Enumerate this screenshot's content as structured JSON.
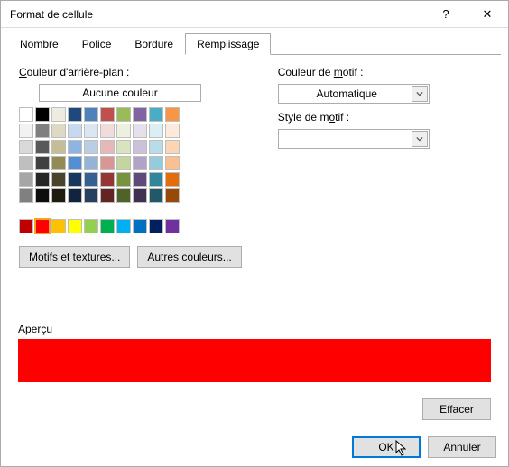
{
  "window": {
    "title": "Format de cellule",
    "help_icon": "?",
    "close_icon": "✕"
  },
  "tabs": {
    "number": "Nombre",
    "font": "Police",
    "border": "Bordure",
    "fill": "Remplissage"
  },
  "fill": {
    "bg_label_pre": "C",
    "bg_label_mid": "ouleur d'arrière-plan :",
    "no_color": "Aucune couleur",
    "effects_btn": "Motifs et textures...",
    "more_colors_btn": "Autres couleurs...",
    "theme_rows": [
      [
        "#ffffff",
        "#000000",
        "#eeece1",
        "#1f497d",
        "#4f81bd",
        "#c0504d",
        "#9bbb59",
        "#8064a2",
        "#4bacc6",
        "#f79646"
      ],
      [
        "#f2f2f2",
        "#7f7f7f",
        "#ddd9c4",
        "#c6d9f1",
        "#dce6f2",
        "#f2dcdb",
        "#ebf1de",
        "#e6e0ec",
        "#dbeef4",
        "#fdeada"
      ],
      [
        "#d9d9d9",
        "#595959",
        "#c4bd97",
        "#8eb4e3",
        "#b9cde5",
        "#e6b9b8",
        "#d7e4bd",
        "#ccc1da",
        "#b7dee8",
        "#fcd5b5"
      ],
      [
        "#bfbfbf",
        "#404040",
        "#948a54",
        "#548ed5",
        "#95b3d7",
        "#da9694",
        "#c3d69b",
        "#b3a2c7",
        "#93cddd",
        "#fac090"
      ],
      [
        "#a6a6a6",
        "#262626",
        "#4a452a",
        "#17375e",
        "#376092",
        "#963634",
        "#77933c",
        "#604a7b",
        "#31869b",
        "#e46c0a"
      ],
      [
        "#808080",
        "#0d0d0d",
        "#1e1c11",
        "#10243f",
        "#254061",
        "#632523",
        "#4f6228",
        "#403152",
        "#215968",
        "#984807"
      ]
    ],
    "standard_row": [
      "#c00000",
      "#ff0000",
      "#ffc000",
      "#ffff00",
      "#92d050",
      "#00b050",
      "#00b0f0",
      "#0070c0",
      "#002060",
      "#7030a0"
    ],
    "selected_color": "#ff0000"
  },
  "pattern": {
    "color_label": "Couleur de ",
    "color_label_u": "m",
    "color_label_post": "otif :",
    "auto": "Automatique",
    "style_label": "Style de m",
    "style_label_u": "o",
    "style_label_post": "tif :"
  },
  "preview": {
    "label": "Aperçu",
    "color": "#ff0000"
  },
  "buttons": {
    "clear": "Effacer",
    "ok": "OK",
    "cancel": "Annuler"
  }
}
